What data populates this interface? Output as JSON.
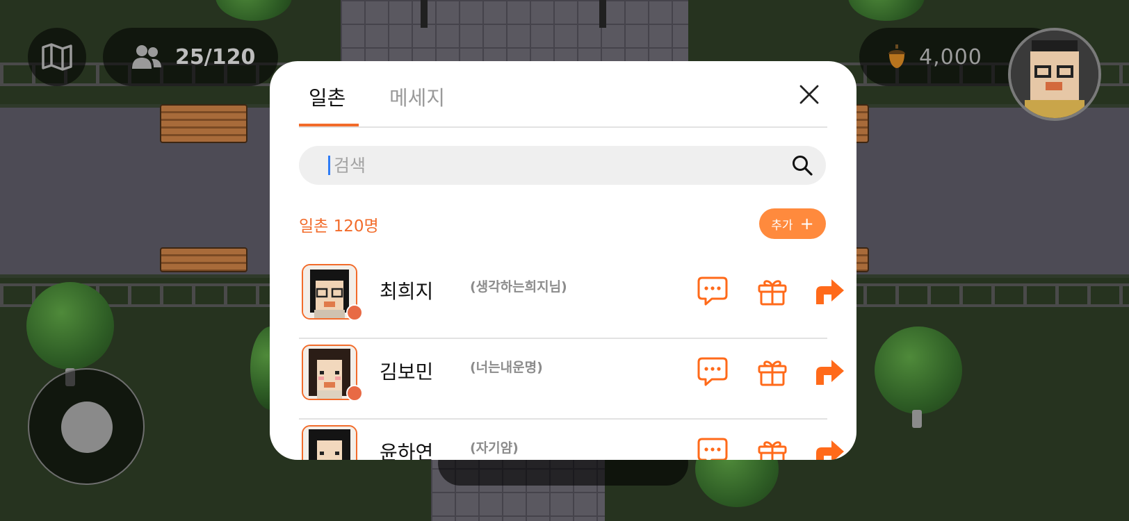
{
  "hud": {
    "users_count": "25/120",
    "coins": "4,000"
  },
  "modal": {
    "tabs": [
      {
        "label": "일촌",
        "active": true
      },
      {
        "label": "메세지",
        "active": false
      }
    ],
    "search": {
      "placeholder": "검색",
      "value": ""
    },
    "friends_count_label": "일촌 120명",
    "add_button_label": "추가",
    "friends": [
      {
        "name": "최희지",
        "nickname": "(생각하는희지님)",
        "online": true
      },
      {
        "name": "김보민",
        "nickname": "(너는내운명)",
        "online": true
      },
      {
        "name": "윤하연",
        "nickname": "(자기얌)",
        "online": false
      }
    ]
  },
  "colors": {
    "accent": "#f26b2a",
    "add_button": "#ff8a3d",
    "online_dot": "#e86a45"
  },
  "icons": [
    "map-icon",
    "users-icon",
    "acorn-icon",
    "close-icon",
    "search-icon",
    "chat-bubble-icon",
    "gift-icon",
    "share-arrow-icon"
  ]
}
